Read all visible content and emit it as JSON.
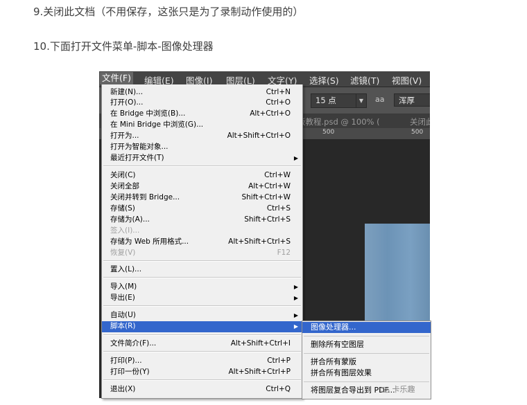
{
  "article": {
    "line1": "9.关闭此文档（不用保存，这张只是为了录制动作使用的）",
    "line2": "10.下面打开文件菜单-脚本-图像处理器"
  },
  "menubar": [
    "文件(F)",
    "编辑(E)",
    "图像(I)",
    "图层(L)",
    "文字(Y)",
    "选择(S)",
    "滤镜(T)",
    "视图(V)"
  ],
  "options": {
    "font_size": "15 点",
    "aa_icon": "aa",
    "aa_value": "浑厚"
  },
  "tabs": {
    "doc": "板教程.psd @ 100% (",
    "close_hint": "关闭此"
  },
  "ruler": [
    "500",
    "500"
  ],
  "file_menu": [
    {
      "label": "新建(N)...",
      "shortcut": "Ctrl+N"
    },
    {
      "label": "打开(O)...",
      "shortcut": "Ctrl+O"
    },
    {
      "label": "在 Bridge 中浏览(B)...",
      "shortcut": "Alt+Ctrl+O"
    },
    {
      "label": "在 Mini Bridge 中浏览(G)...",
      "shortcut": ""
    },
    {
      "label": "打开为...",
      "shortcut": "Alt+Shift+Ctrl+O"
    },
    {
      "label": "打开为智能对象...",
      "shortcut": ""
    },
    {
      "label": "最近打开文件(T)",
      "shortcut": ""
    },
    {
      "label": "关闭(C)",
      "shortcut": "Ctrl+W"
    },
    {
      "label": "关闭全部",
      "shortcut": "Alt+Ctrl+W"
    },
    {
      "label": "关闭并转到 Bridge...",
      "shortcut": "Shift+Ctrl+W"
    },
    {
      "label": "存储(S)",
      "shortcut": "Ctrl+S"
    },
    {
      "label": "存储为(A)...",
      "shortcut": "Shift+Ctrl+S"
    },
    {
      "label": "签入(I)...",
      "shortcut": ""
    },
    {
      "label": "存储为 Web 所用格式...",
      "shortcut": "Alt+Shift+Ctrl+S"
    },
    {
      "label": "恢复(V)",
      "shortcut": "F12"
    },
    {
      "label": "置入(L)...",
      "shortcut": ""
    },
    {
      "label": "导入(M)",
      "shortcut": ""
    },
    {
      "label": "导出(E)",
      "shortcut": ""
    },
    {
      "label": "自动(U)",
      "shortcut": ""
    },
    {
      "label": "脚本(R)",
      "shortcut": ""
    },
    {
      "label": "文件简介(F)...",
      "shortcut": "Alt+Shift+Ctrl+I"
    },
    {
      "label": "打印(P)...",
      "shortcut": "Ctrl+P"
    },
    {
      "label": "打印一份(Y)",
      "shortcut": "Alt+Shift+Ctrl+P"
    },
    {
      "label": "退出(X)",
      "shortcut": "Ctrl+Q"
    }
  ],
  "script_submenu": [
    "图像处理器...",
    "删除所有空图层",
    "拼合所有蒙版",
    "拼合所有图层效果",
    "将图层复合导出到 PDF..."
  ],
  "watermark": "卡乐趣",
  "colors": {
    "highlight": "#3366cc",
    "menu_bg": "#f0f0f0",
    "ps_dark": "#2b2b2b"
  }
}
